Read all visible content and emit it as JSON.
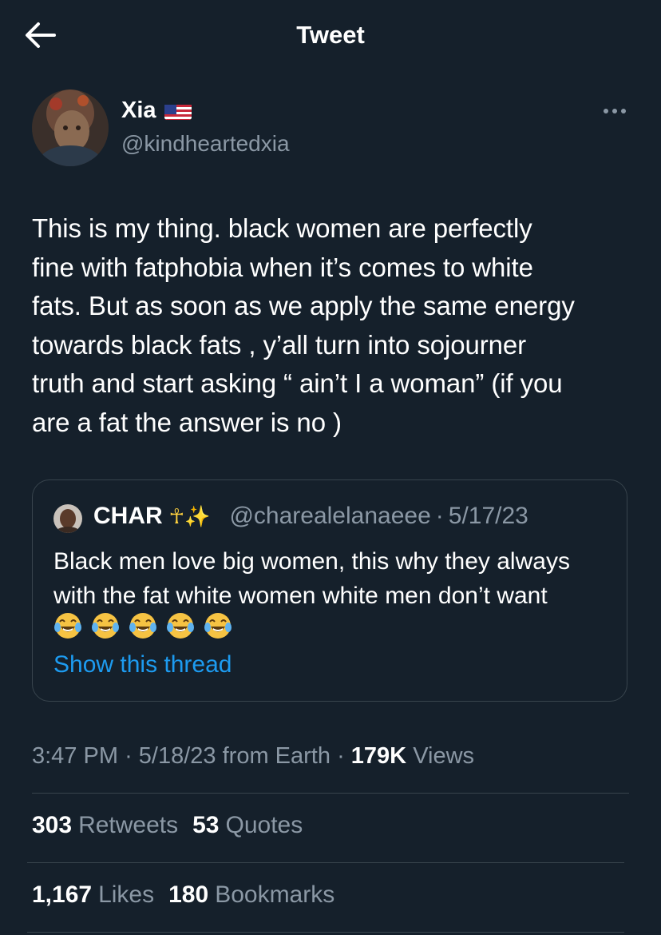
{
  "header": {
    "title": "Tweet",
    "back_icon": "arrow-left-icon"
  },
  "author": {
    "name": "Xia",
    "flag_icon": "us-flag-icon",
    "handle": "@kindheartedxia"
  },
  "tweet": {
    "text": "This is my thing. black women are perfectly\nfine with fatphobia when it’s comes to white\nfats. But as soon as we apply the same energy\ntowards black fats , y’all turn into sojourner\ntruth and start asking “ ain’t I a woman” (if you\nare a fat the answer is no )"
  },
  "quote": {
    "name": "CHAR",
    "badges": "☥✨",
    "handle": "@charealelanaeee",
    "date_sep": "·",
    "date": "5/17/23",
    "text": "Black men love big women, this why they always\nwith the fat white women white men don’t want",
    "emoji_icon": "tears-of-joy-emoji",
    "emoji_count": 5,
    "thread_link": "Show this thread"
  },
  "meta": {
    "time": "3:47 PM",
    "sep1": "·",
    "date": "5/18/23",
    "source": "from Earth",
    "sep2": "·",
    "views_count": "179K",
    "views_label": "Views"
  },
  "stats_row1": [
    {
      "count": "303",
      "label": "Retweets"
    },
    {
      "count": "53",
      "label": "Quotes"
    }
  ],
  "stats_row2": [
    {
      "count": "1,167",
      "label": "Likes"
    },
    {
      "count": "180",
      "label": "Bookmarks"
    }
  ],
  "colors": {
    "background": "#15202b",
    "secondary_text": "#8b98a5",
    "link": "#1d9bf0",
    "border": "#38444d"
  }
}
